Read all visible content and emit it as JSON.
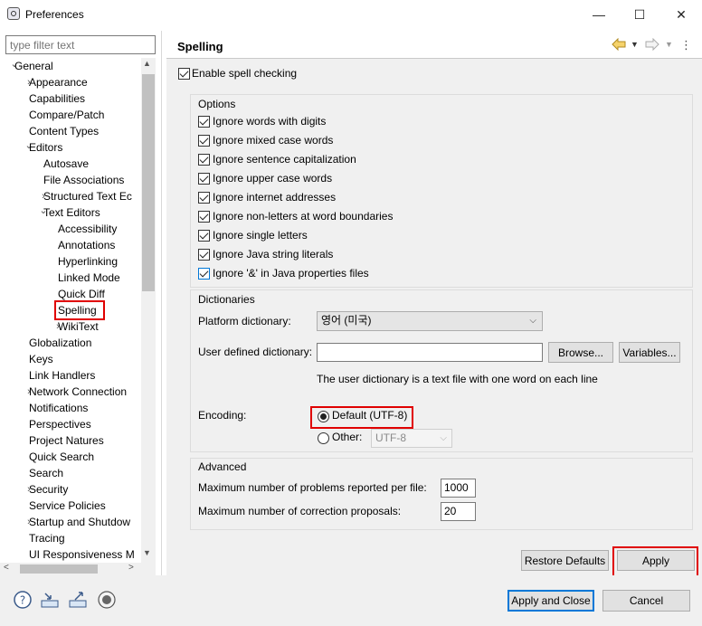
{
  "window": {
    "title": "Preferences",
    "minimize": "—",
    "maximize": "☐",
    "close": "✕"
  },
  "filter": {
    "placeholder": "type filter text"
  },
  "tree": [
    {
      "label": "General",
      "level": 0,
      "twisty": "v"
    },
    {
      "label": "Appearance",
      "level": 1,
      "twisty": ">"
    },
    {
      "label": "Capabilities",
      "level": 1,
      "twisty": ""
    },
    {
      "label": "Compare/Patch",
      "level": 1,
      "twisty": ""
    },
    {
      "label": "Content Types",
      "level": 1,
      "twisty": ""
    },
    {
      "label": "Editors",
      "level": 1,
      "twisty": "v"
    },
    {
      "label": "Autosave",
      "level": 2,
      "twisty": ""
    },
    {
      "label": "File Associations",
      "level": 2,
      "twisty": ""
    },
    {
      "label": "Structured Text Ec",
      "level": 2,
      "twisty": ">"
    },
    {
      "label": "Text Editors",
      "level": 2,
      "twisty": "v"
    },
    {
      "label": "Accessibility",
      "level": 3,
      "twisty": ""
    },
    {
      "label": "Annotations",
      "level": 3,
      "twisty": ""
    },
    {
      "label": "Hyperlinking",
      "level": 3,
      "twisty": ""
    },
    {
      "label": "Linked Mode",
      "level": 3,
      "twisty": ""
    },
    {
      "label": "Quick Diff",
      "level": 3,
      "twisty": ""
    },
    {
      "label": "Spelling",
      "level": 3,
      "twisty": "",
      "selected": true
    },
    {
      "label": "WikiText",
      "level": 3,
      "twisty": ">"
    },
    {
      "label": "Globalization",
      "level": 1,
      "twisty": ""
    },
    {
      "label": "Keys",
      "level": 1,
      "twisty": ""
    },
    {
      "label": "Link Handlers",
      "level": 1,
      "twisty": ""
    },
    {
      "label": "Network Connection",
      "level": 1,
      "twisty": ">"
    },
    {
      "label": "Notifications",
      "level": 1,
      "twisty": ""
    },
    {
      "label": "Perspectives",
      "level": 1,
      "twisty": ""
    },
    {
      "label": "Project Natures",
      "level": 1,
      "twisty": ""
    },
    {
      "label": "Quick Search",
      "level": 1,
      "twisty": ""
    },
    {
      "label": "Search",
      "level": 1,
      "twisty": ""
    },
    {
      "label": "Security",
      "level": 1,
      "twisty": ">"
    },
    {
      "label": "Service Policies",
      "level": 1,
      "twisty": ""
    },
    {
      "label": "Startup and Shutdow",
      "level": 1,
      "twisty": ">"
    },
    {
      "label": "Tracing",
      "level": 1,
      "twisty": ""
    },
    {
      "label": "UI Responsiveness M",
      "level": 1,
      "twisty": ""
    }
  ],
  "page": {
    "title": "Spelling",
    "enable_label": "Enable spell checking",
    "options_title": "Options",
    "options": [
      "Ignore words with digits",
      "Ignore mixed case words",
      "Ignore sentence capitalization",
      "Ignore upper case words",
      "Ignore internet addresses",
      "Ignore non-letters at word boundaries",
      "Ignore single letters",
      "Ignore Java string literals",
      "Ignore '&' in Java properties files"
    ],
    "dictionaries_title": "Dictionaries",
    "platform_label": "Platform dictionary:",
    "platform_value": "영어 (미국)",
    "user_dict_label": "User defined dictionary:",
    "user_dict_value": "",
    "browse_label": "Browse...",
    "variables_label": "Variables...",
    "user_dict_hint": "The user dictionary is a text file with one word on each line",
    "encoding_label": "Encoding:",
    "default_encoding": "Default (UTF-8)",
    "other_label": "Other:",
    "other_value": "UTF-8",
    "advanced_title": "Advanced",
    "max_problems_label": "Maximum number of problems reported per file:",
    "max_problems_value": "1000",
    "max_corrections_label": "Maximum number of correction proposals:",
    "max_corrections_value": "20",
    "restore_label": "Restore Defaults",
    "apply_label": "Apply"
  },
  "footer": {
    "apply_close_label": "Apply and Close",
    "cancel_label": "Cancel"
  },
  "colors": {
    "highlight": "#e00000",
    "focus_blue": "#0078d7",
    "panel": "#f0f0f0"
  }
}
